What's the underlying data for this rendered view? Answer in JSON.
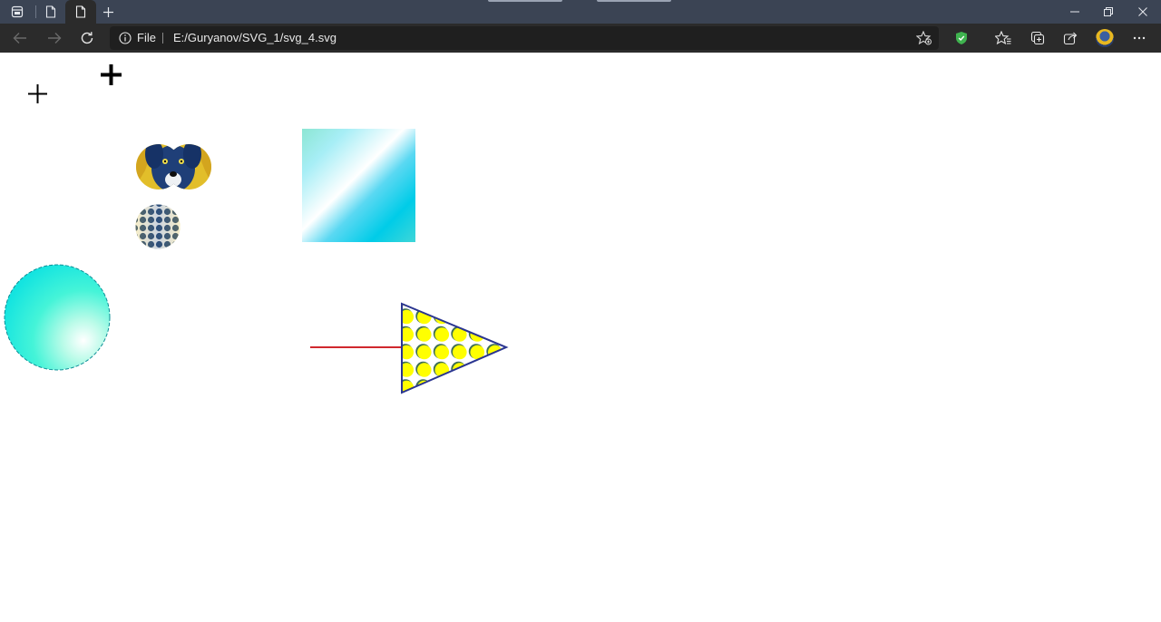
{
  "browser": {
    "tabs": [
      {
        "label": "",
        "icon": "page-icon",
        "active": false
      },
      {
        "label": "",
        "icon": "page-icon",
        "active": true
      }
    ],
    "address_bar": {
      "scheme_label": "File",
      "url": "E:/Guryanov/SVG_1/svg_4.svg"
    }
  },
  "colors": {
    "tabbar_bg": "#3b4454",
    "toolbar_bg": "#2b2b2b",
    "address_bg": "#1f1f1f",
    "shield": "#3fb34f"
  },
  "page": {
    "shapes": [
      {
        "name": "dog-image-clip",
        "kind": "two overlapping circles clipping a photo of a blue dog"
      },
      {
        "name": "pattern-circle",
        "kind": "small circle filled with dot pattern of the dog image"
      },
      {
        "name": "gradient-square",
        "kind": "square with diagonal cyan/white linear gradient"
      },
      {
        "name": "gradient-sphere",
        "kind": "circle with radial cyan gradient and dashed teal stroke"
      },
      {
        "name": "red-line",
        "kind": "horizontal red line"
      },
      {
        "name": "dotted-triangle",
        "kind": "triangle with navy stroke and yellow dot pattern fill"
      }
    ],
    "colors": {
      "line": "#d0282e",
      "triangle_stroke": "#2a3590",
      "dot_fill": "#ffff00",
      "dot_shadow": "#3f6f55",
      "sphere_stroke": "#0e8f97"
    }
  }
}
